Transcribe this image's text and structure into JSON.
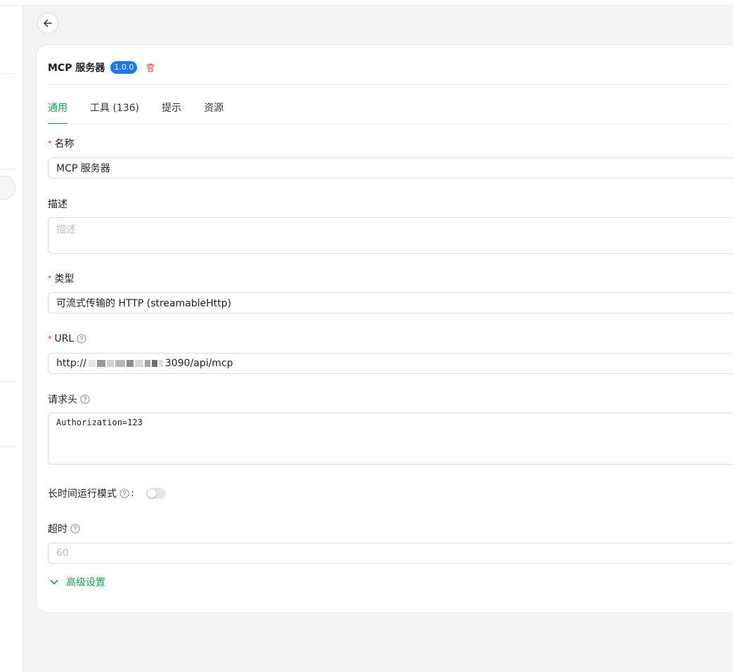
{
  "header": {
    "title": "MCP 服务器",
    "version": "1.0.0"
  },
  "tabs": [
    {
      "label": "通用",
      "active": true
    },
    {
      "label": "工具 (136)",
      "active": false
    },
    {
      "label": "提示",
      "active": false
    },
    {
      "label": "资源",
      "active": false
    }
  ],
  "form": {
    "name": {
      "label": "名称",
      "required": true,
      "value": "MCP 服务器"
    },
    "description": {
      "label": "描述",
      "required": false,
      "placeholder": "描述"
    },
    "type": {
      "label": "类型",
      "required": true,
      "value": "可流式传输的 HTTP (streamableHttp)"
    },
    "url": {
      "label": "URL",
      "required": true,
      "value_prefix": "http://",
      "value_suffix": "3090/api/mcp"
    },
    "headers": {
      "label": "请求头",
      "value": "Authorization=123"
    },
    "long_running": {
      "label": "长时间运行模式",
      "suffix": ":",
      "enabled": false
    },
    "timeout": {
      "label": "超时",
      "placeholder": "60"
    },
    "advanced_label": "高级设置"
  },
  "colors": {
    "accent": "#16a34a",
    "badge": "#1677ff",
    "danger": "#ff4d4f"
  },
  "icons": {
    "back": "arrow-left-icon",
    "delete": "trash-icon",
    "help": "question-circle-icon",
    "expand": "chevron-down-icon"
  }
}
